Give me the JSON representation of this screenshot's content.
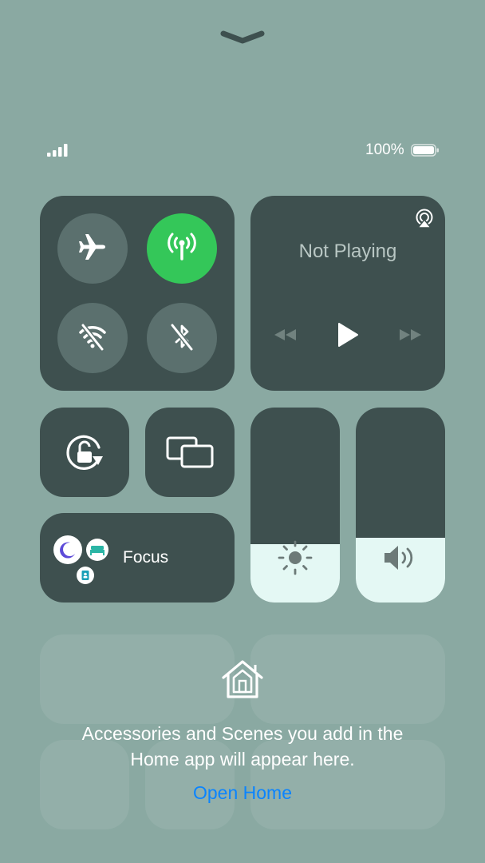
{
  "status_bar": {
    "battery_percent": "100%",
    "signal_bars": 4
  },
  "connectivity": {
    "airplane": {
      "label": "Airplane Mode",
      "on": false
    },
    "cellular": {
      "label": "Cellular Data",
      "on": true
    },
    "wifi": {
      "label": "Wi-Fi",
      "on": false
    },
    "bluetooth": {
      "label": "Bluetooth",
      "on": false
    }
  },
  "media": {
    "title": "Not Playing"
  },
  "focus": {
    "label": "Focus"
  },
  "sliders": {
    "brightness_level": 0.3,
    "volume_level": 0.33
  },
  "home": {
    "message_line1": "Accessories and Scenes you add in the",
    "message_line2": "Home app will appear here.",
    "link": "Open Home"
  },
  "colors": {
    "background": "#8aa9a2",
    "tile": "#3e504f",
    "cellular_on": "#34c759",
    "link": "#0a84ff",
    "slider_fill": "#e4f8f4"
  }
}
